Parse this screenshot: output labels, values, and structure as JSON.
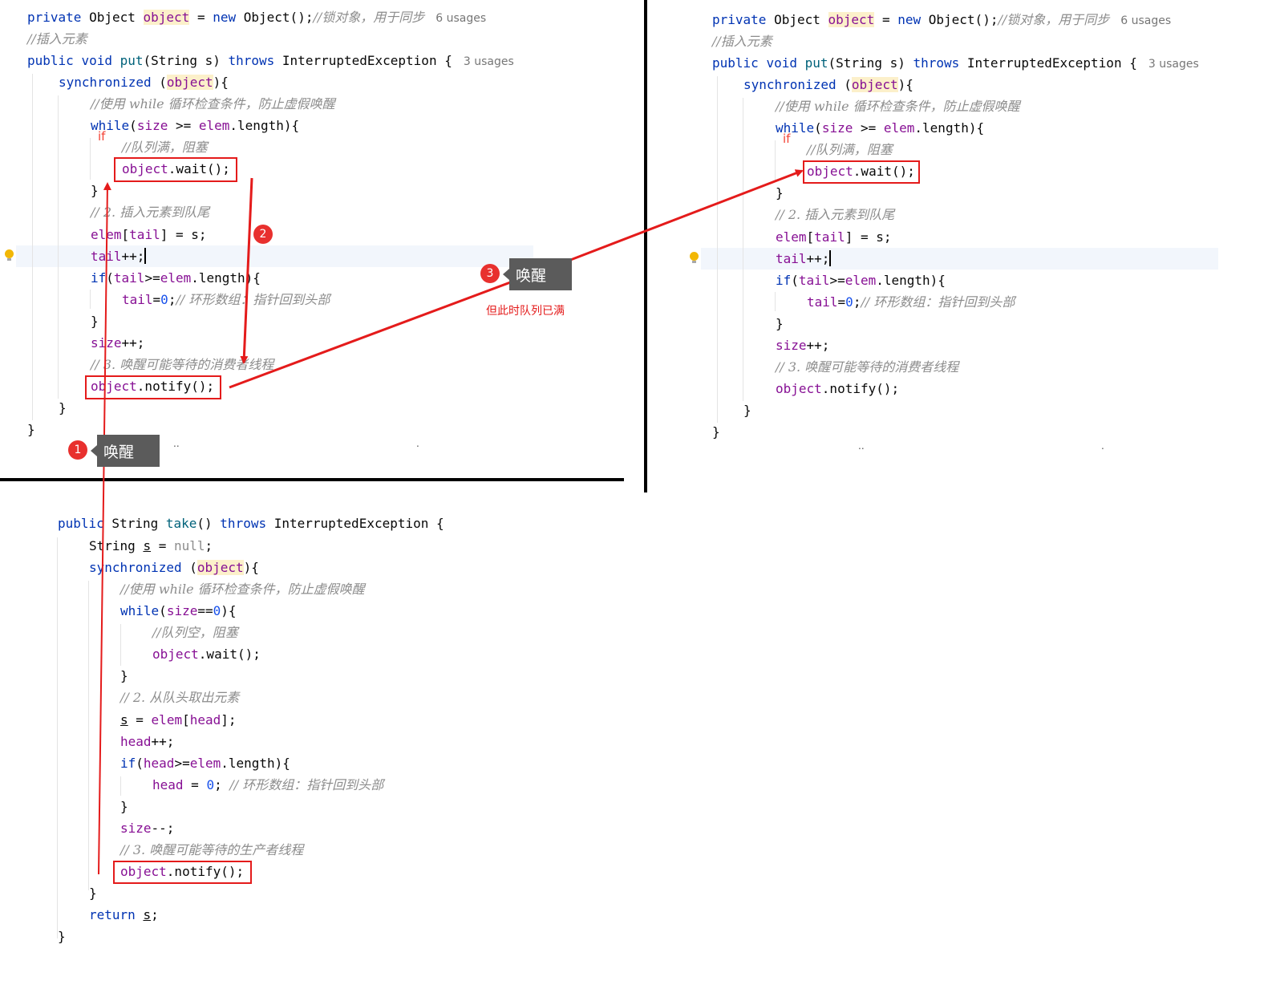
{
  "put_code": {
    "l1_private": "private",
    "l1_type": "Object",
    "l1_var": "object",
    "l1_eq": " = ",
    "l1_new": "new",
    "l1_ctor": " Object();",
    "l1_comment": "//锁对象，用于同步",
    "l1_usages": "6 usages",
    "l2_comment": "//插入元素",
    "l3_public": "public",
    "l3_void": "void",
    "l3_put": "put",
    "l3_sig": "(String s) ",
    "l3_throws": "throws",
    "l3_exc": " InterruptedException {",
    "l3_usages": "3 usages",
    "l4_sync": "synchronized",
    "l4_open": " (",
    "l4_obj": "object",
    "l4_close": "){",
    "l5_comment": "//使用 while 循环检查条件，防止虚假唤醒",
    "l6_while": "while",
    "l6_p": "(",
    "l6_size": "size",
    "l6_ge": " >= ",
    "l6_elem": "elem",
    "l6_len": ".length",
    "l6_end": "){",
    "l7_comment": "//队列满，阻塞",
    "l8_obj": "object",
    "l8_wait": ".wait();",
    "l9": "}",
    "l10_comment": "// 2. 插入元素到队尾",
    "l11_elem": "elem",
    "l11_b": "[",
    "l11_tail": "tail",
    "l11_rest": "] = s;",
    "l12_tail": "tail",
    "l12_inc": "++;",
    "l13_if": "if",
    "l13_p": "(",
    "l13_tail": "tail",
    "l13_ge": ">=",
    "l13_elem": "elem",
    "l13_len": ".length",
    "l13_end": "){",
    "l14_tail": "tail",
    "l14_eq": "=",
    "l14_zero": "0",
    "l14_semi": ";",
    "l14_comment": "// 环形数组：指针回到头部",
    "l15": "}",
    "l16_size": "size",
    "l16_inc": "++;",
    "l17_comment": "// 3. 唤醒可能等待的消费者线程",
    "l18_obj": "object",
    "l18_notify": ".notify();",
    "l19": "}",
    "l20": "}"
  },
  "take_code": {
    "l1_public": "public",
    "l1_type": " String ",
    "l1_take": "take",
    "l1_p": "() ",
    "l1_throws": "throws",
    "l1_exc": " InterruptedException {",
    "l2_type": "String ",
    "l2_s": "s",
    "l2_eq": " = ",
    "l2_null": "null",
    "l2_semi": ";",
    "l3_sync": "synchronized",
    "l3_open": " (",
    "l3_obj": "object",
    "l3_close": "){",
    "l4_comment": "//使用 while 循环检查条件，防止虚假唤醒",
    "l5_while": "while",
    "l5_p": "(",
    "l5_size": "size",
    "l5_eq": "==",
    "l5_zero": "0",
    "l5_end": "){",
    "l6_comment": "//队列空，阻塞",
    "l7_obj": "object",
    "l7_wait": ".wait();",
    "l8": "}",
    "l9_comment": "// 2. 从队头取出元素",
    "l10_s": "s",
    "l10_eq": " = ",
    "l10_elem": "elem",
    "l10_b": "[",
    "l10_head": "head",
    "l10_end": "];",
    "l11_head": "head",
    "l11_inc": "++;",
    "l12_if": "if",
    "l12_p": "(",
    "l12_head": "head",
    "l12_ge": ">=",
    "l12_elem": "elem",
    "l12_len": ".length",
    "l12_end": "){",
    "l13_head": "head",
    "l13_eq": " = ",
    "l13_zero": "0",
    "l13_semi": "; ",
    "l13_comment": "// 环形数组：指针回到头部",
    "l14": "}",
    "l15_size": "size",
    "l15_dec": "--;",
    "l16_comment": "// 3. 唤醒可能等待的生产者线程",
    "l17_obj": "object",
    "l17_notify": ".notify();",
    "l18": "}",
    "l19_return": "return",
    "l19_sp": " ",
    "l19_s": "s",
    "l19_semi": ";",
    "l20": "}"
  },
  "annotations": {
    "if_label": "if",
    "step1_badge": "1",
    "step1_tip": "唤醒",
    "step2_badge": "2",
    "step3_badge": "3",
    "step3_tip": "唤醒",
    "step3_note": "但此时队列已满"
  },
  "colors": {
    "keyword": "#0033b3",
    "method": "#00627a",
    "field": "#871094",
    "number": "#1750eb",
    "comment": "#8c8c8c",
    "highlight": "#fcf0ca",
    "annotation_red": "#e41b1b",
    "tooltip_bg": "#5b5b5b"
  },
  "icons": [
    "lightbulb-icon"
  ]
}
